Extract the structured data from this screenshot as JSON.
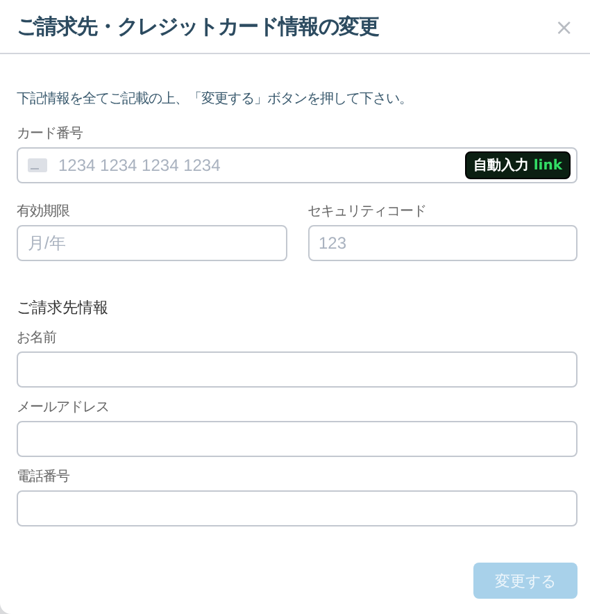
{
  "dialog": {
    "title": "ご請求先・クレジットカード情報の変更",
    "close": "×"
  },
  "intro": "下記情報を全てご記載の上、「変更する」ボタンを押して下さい。",
  "card_number": {
    "label": "カード番号",
    "placeholder": "1234 1234 1234 1234",
    "autofill": {
      "label": "自動入力",
      "brand": "link"
    }
  },
  "card_row": [
    {
      "label": "有効期限",
      "placeholder": "月/年"
    },
    {
      "label": "セキュリティコード",
      "placeholder": "123"
    }
  ],
  "billing": {
    "heading": "ご請求先情報",
    "fields": [
      {
        "label": "お名前"
      },
      {
        "label": "メールアドレス"
      },
      {
        "label": "電話番号"
      }
    ]
  },
  "submit": {
    "label": "変更する",
    "disabled": true
  }
}
